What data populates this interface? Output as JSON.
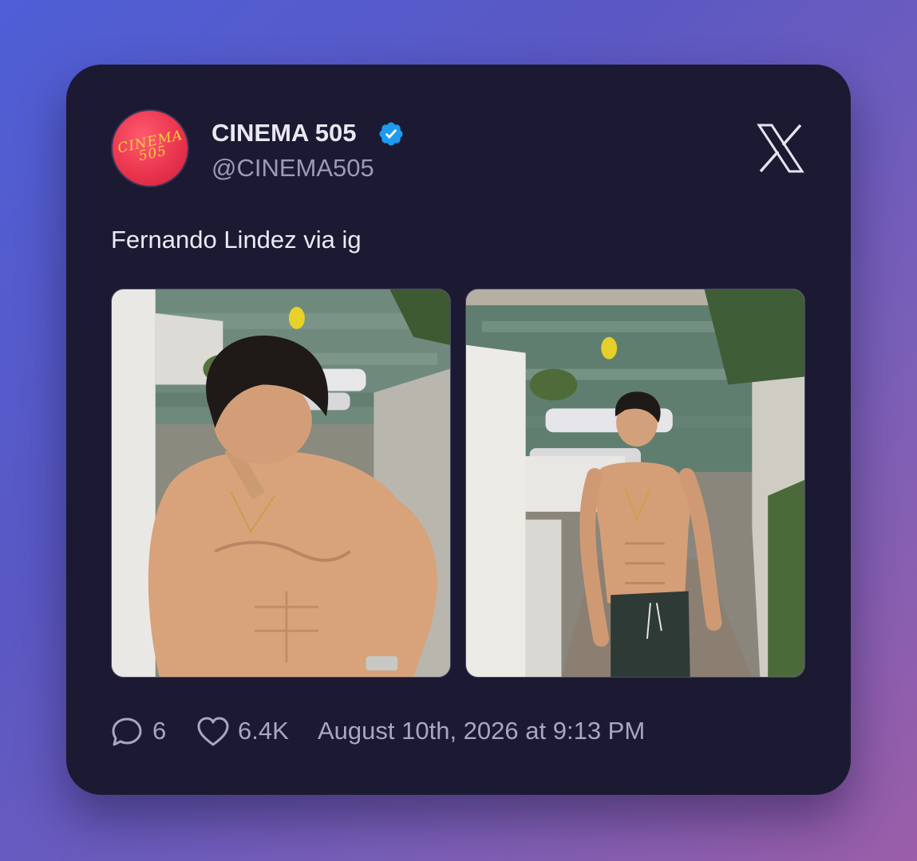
{
  "author": {
    "display_name": "CINEMA 505",
    "handle": "@CINEMA505",
    "verified": true,
    "avatar_text": [
      "CINEMA",
      "505"
    ]
  },
  "platform_icon": "x-logo-icon",
  "tweet": {
    "text": "Fernando Lindez via ig"
  },
  "media": [
    {
      "icon": "photo-man-by-water-closeup"
    },
    {
      "icon": "photo-man-on-stairs-fullbody"
    }
  ],
  "stats": {
    "replies": "6",
    "likes": "6.4K",
    "timestamp": "August 10th, 2026 at 9:13 PM"
  },
  "colors": {
    "card_bg": "#1c1a32",
    "verified_blue": "#1d9bf0",
    "avatar_red": "#e8324c",
    "avatar_text": "#f2d23c"
  }
}
